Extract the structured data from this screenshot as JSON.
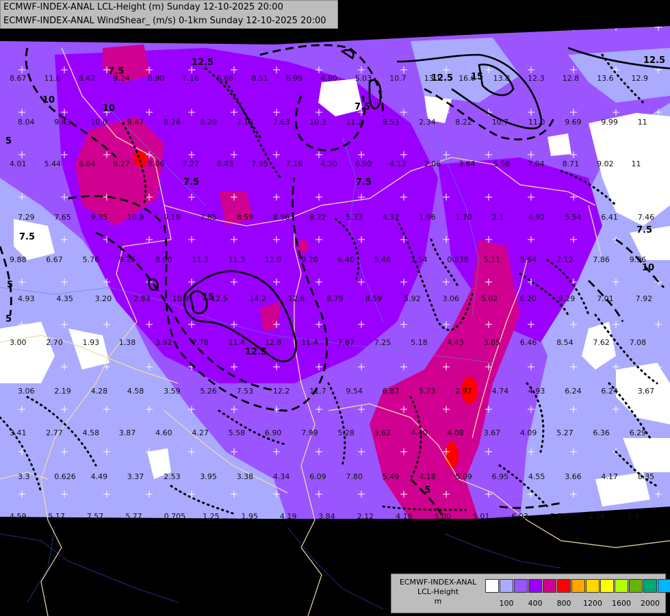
{
  "header": {
    "line1": "ECMWF-INDEX-ANAL LCL-Height (m) Sunday 12-10-2025 20:00",
    "line2": "ECMWF-INDEX-ANAL WindShear_ (m/s) 0-1km Sunday 12-10-2025 20:00"
  },
  "legend": {
    "title_lines": [
      "ECMWF-INDEX-ANAL",
      "LCL-Height",
      "m"
    ],
    "colors": [
      "#ffffff",
      "#aaaaff",
      "#9a55ff",
      "#9a00ff",
      "#d00090",
      "#ff0000",
      "#ffa500",
      "#ffd700",
      "#ffff00",
      "#b4ff00",
      "#66b300",
      "#00a878",
      "#00b4ff"
    ],
    "ticks": [
      "100",
      "400",
      "800",
      "1200",
      "1600",
      "2000"
    ]
  },
  "contour_labels": [
    "7.5",
    "10",
    "7.5",
    "10",
    "12.5",
    "15",
    "12.5",
    "12.5",
    "15",
    "7.5",
    "5",
    "5",
    "7.5",
    "7.5",
    "10",
    "7.5",
    "12.5",
    "5",
    "5"
  ],
  "station_values": [
    "8.67",
    "11.6",
    "8.47",
    "9.24",
    "8.90",
    "7.16",
    "5.66",
    "8.51",
    "8.99",
    "4.90",
    "5.03",
    "10.7",
    "13.1",
    "16.6",
    "13.8",
    "12.3",
    "12.8",
    "13.6",
    "12.9",
    "8.04",
    "9.43",
    "10.0",
    "9.47",
    "8.24",
    "8.29",
    "7.13",
    "7.63",
    "10.3",
    "11.2",
    "8.53",
    "2.34",
    "8.22",
    "10.7",
    "11.0",
    "9.69",
    "9.99",
    "11",
    "4.01",
    "5.44",
    "6.64",
    "9.27",
    "9.06",
    "7.27",
    "8.43",
    "7.95",
    "7.16",
    "4.30",
    "6.90",
    "4.13",
    "2.06",
    "3.64",
    "5.58",
    "7.04",
    "8.71",
    "9.02",
    "11",
    "7.29",
    "7.65",
    "9.35",
    "10.9",
    "9.19",
    "7.85",
    "8.59",
    "8.96",
    "8.22",
    "5.33",
    "4.37",
    "1.96",
    "1.70",
    "2.1",
    "4.92",
    "5.54",
    "6.41",
    "7.46",
    "9.88",
    "6.67",
    "5.76",
    "9.26",
    "8.00",
    "11.3",
    "11.3",
    "12.0",
    "9.20",
    "6.40",
    "5.46",
    "1.54",
    "0.838",
    "5.11",
    "5.64",
    "7.12",
    "7.86",
    "9.96",
    "4.93",
    "4.35",
    "3.20",
    "2.83",
    "10.9",
    "12.5",
    "14.2",
    "12.6",
    "8.79",
    "8.59",
    "5.92",
    "3.06",
    "5.02",
    "6.20",
    "9.29",
    "7.01",
    "7.92",
    "3.00",
    "2.70",
    "1.93",
    "1.38",
    "3.92",
    "7.78",
    "11.4",
    "12.8",
    "11.4",
    "7.67",
    "7.25",
    "5.18",
    "4.43",
    "3.85",
    "6.46",
    "8.54",
    "7.62",
    "7.08",
    "3.06",
    "2.19",
    "4.28",
    "4.58",
    "3.59",
    "5.26",
    "7.53",
    "12.2",
    "11.7",
    "9.54",
    "6.87",
    "5.23",
    "2.97",
    "4.74",
    "4.93",
    "6.24",
    "6.24",
    "3.67",
    "3.41",
    "2.77",
    "4.58",
    "3.87",
    "4.60",
    "4.27",
    "5.58",
    "6.90",
    "7.99",
    "5.28",
    "3.62",
    "4.40",
    "4.08",
    "3.67",
    "4.09",
    "5.27",
    "6.36",
    "6.29",
    "3.3",
    "0.626",
    "4.49",
    "3.37",
    "2.53",
    "3.95",
    "3.38",
    "4.34",
    "6.09",
    "7.80",
    "5.49",
    "4.18",
    "5.09",
    "6.95",
    "4.55",
    "3.66",
    "4.17",
    "8.35",
    "4.59",
    "5.17",
    "7.57",
    "5.77",
    "0.705",
    "1.25",
    "1.95",
    "4.19",
    "3.84",
    "2.12",
    "4.18",
    "5.00",
    "5.01",
    "6.03",
    "5.53",
    "2.16",
    "1.8"
  ]
}
